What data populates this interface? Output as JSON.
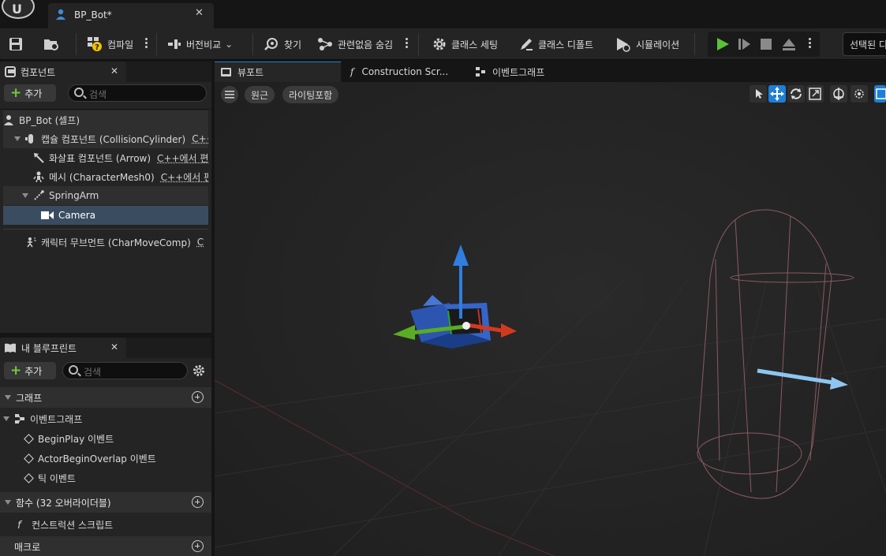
{
  "document_tab": {
    "title": "BP_Bot*",
    "close": "✕"
  },
  "toolbar": {
    "compile": "컴파일",
    "diff": "버전비교",
    "find": "찾기",
    "hide_unrelated": "관련없음 숨김",
    "class_settings": "클래스 세팅",
    "class_defaults": "클래스 디폴트",
    "simulation": "시뮬레이션",
    "debug_select": "선택된 디"
  },
  "components_panel": {
    "tab": "컴포넌트",
    "add": "추가",
    "search_placeholder": "검색",
    "items": [
      {
        "label": "BP_Bot (셀프)",
        "ext": ""
      },
      {
        "label": "캡슐 컴포넌트 (CollisionCylinder)",
        "ext": "C++"
      },
      {
        "label": "화살표 컴포넌트 (Arrow)",
        "ext": "C++에서 편"
      },
      {
        "label": "메시 (CharacterMesh0)",
        "ext": "C++에서 편"
      },
      {
        "label": "SpringArm",
        "ext": ""
      },
      {
        "label": "Camera",
        "ext": ""
      },
      {
        "label": "캐릭터 무브먼트 (CharMoveComp)",
        "ext": "C"
      }
    ]
  },
  "blueprint_panel": {
    "tab": "내 블루프린트",
    "add": "추가",
    "search_placeholder": "검색",
    "graph_header": "그래프",
    "event_graph": "이벤트그래프",
    "events": [
      "BeginPlay 이벤트",
      "ActorBeginOverlap 이벤트",
      "틱 이벤트"
    ],
    "functions_header": "함수 (32 오버라이더블)",
    "construction_script": "컨스트럭션 스크립트",
    "macros_header": "매크로"
  },
  "viewport_tabs": {
    "viewport": "뷰포트",
    "construction": "Construction Scr...",
    "event_graph": "이벤트그래프"
  },
  "viewport": {
    "perspective": "원근",
    "lighting": "라이팅포함"
  },
  "colors": {
    "accent": "#1e7fd6",
    "play_green": "#5bc236",
    "selection": "#3a4c60"
  }
}
